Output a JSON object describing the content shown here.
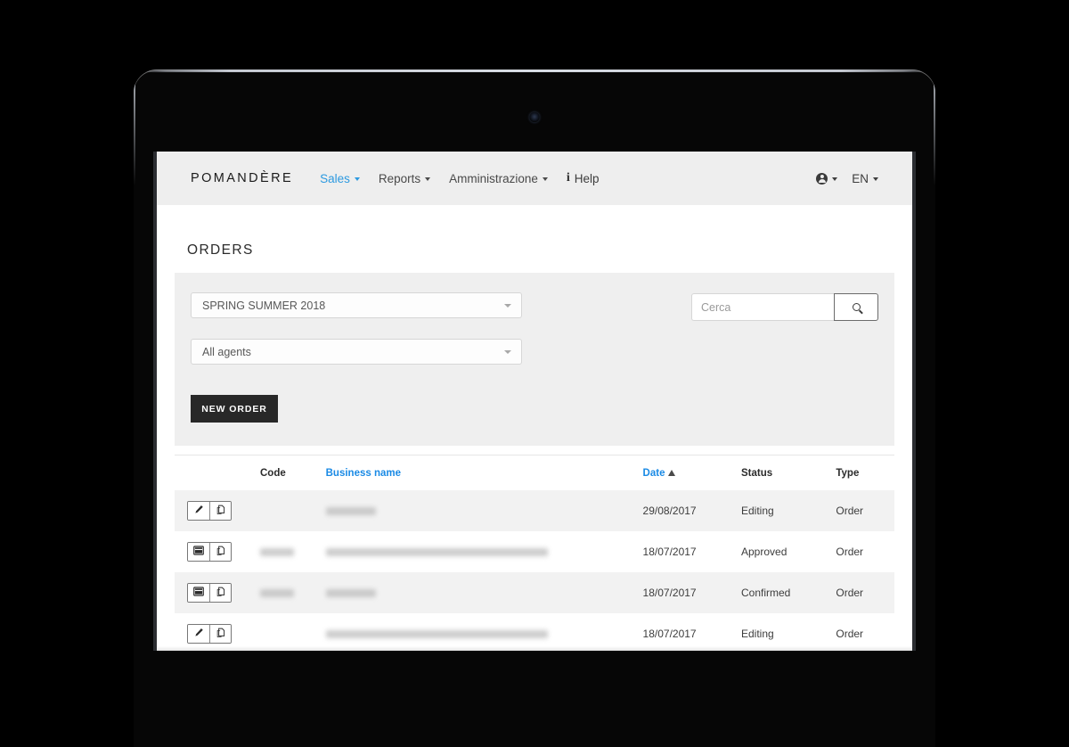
{
  "navbar": {
    "brand": "POMANDÈRE",
    "links": [
      {
        "label": "Sales",
        "active": true,
        "caret": true
      },
      {
        "label": "Reports",
        "active": false,
        "caret": true
      },
      {
        "label": "Amministrazione",
        "active": false,
        "caret": true
      }
    ],
    "help_label": "Help",
    "help_icon": "info-icon",
    "user_icon": "user-circle-icon",
    "language": "EN"
  },
  "page": {
    "title": "ORDERS"
  },
  "filters": {
    "season_select": {
      "value": "SPRING SUMMER 2018",
      "icon": "chevron-down-icon"
    },
    "agent_select": {
      "value": "All agents",
      "icon": "chevron-down-icon"
    },
    "search": {
      "placeholder": "Cerca",
      "value": "",
      "button_icon": "search-icon"
    },
    "new_order_label": "NEW ORDER"
  },
  "table": {
    "columns": [
      {
        "key": "actions",
        "label": "",
        "link": false
      },
      {
        "key": "code",
        "label": "Code",
        "link": false
      },
      {
        "key": "name",
        "label": "Business name",
        "link": true
      },
      {
        "key": "date",
        "label": "Date",
        "link": true,
        "sort": "asc",
        "sort_glyph": "▲"
      },
      {
        "key": "status",
        "label": "Status",
        "link": false
      },
      {
        "key": "type",
        "label": "Type",
        "link": false
      }
    ],
    "rows": [
      {
        "actions": [
          "edit-icon",
          "copy-icon"
        ],
        "code": "",
        "code_redacted": true,
        "code_width": 0,
        "name": "",
        "name_redacted": true,
        "name_width": 56,
        "date": "29/08/2017",
        "status": "Editing",
        "type": "Order",
        "shade": "alt"
      },
      {
        "actions": [
          "view-icon",
          "copy-icon"
        ],
        "code": "",
        "code_redacted": true,
        "code_width": 38,
        "name": "",
        "name_redacted": true,
        "name_width": 249,
        "date": "18/07/2017",
        "status": "Approved",
        "type": "Order",
        "shade": "plain"
      },
      {
        "actions": [
          "view-icon",
          "copy-icon"
        ],
        "code": "",
        "code_redacted": true,
        "code_width": 38,
        "name": "",
        "name_redacted": true,
        "name_width": 56,
        "date": "18/07/2017",
        "status": "Confirmed",
        "type": "Order",
        "shade": "alt"
      },
      {
        "actions": [
          "edit-icon",
          "copy-icon"
        ],
        "code": "",
        "code_redacted": true,
        "code_width": 0,
        "name": "",
        "name_redacted": true,
        "name_width": 249,
        "date": "18/07/2017",
        "status": "Editing",
        "type": "Order",
        "shade": "plain"
      }
    ]
  },
  "colors": {
    "accent_blue": "#1a8ae5",
    "nav_blue": "#2d9ae0",
    "navbar_bg": "#eeeeee",
    "panel_bg": "#efefef",
    "button_dark": "#282828",
    "row_alt": "#f2f2f2",
    "device_black": "#060606"
  }
}
